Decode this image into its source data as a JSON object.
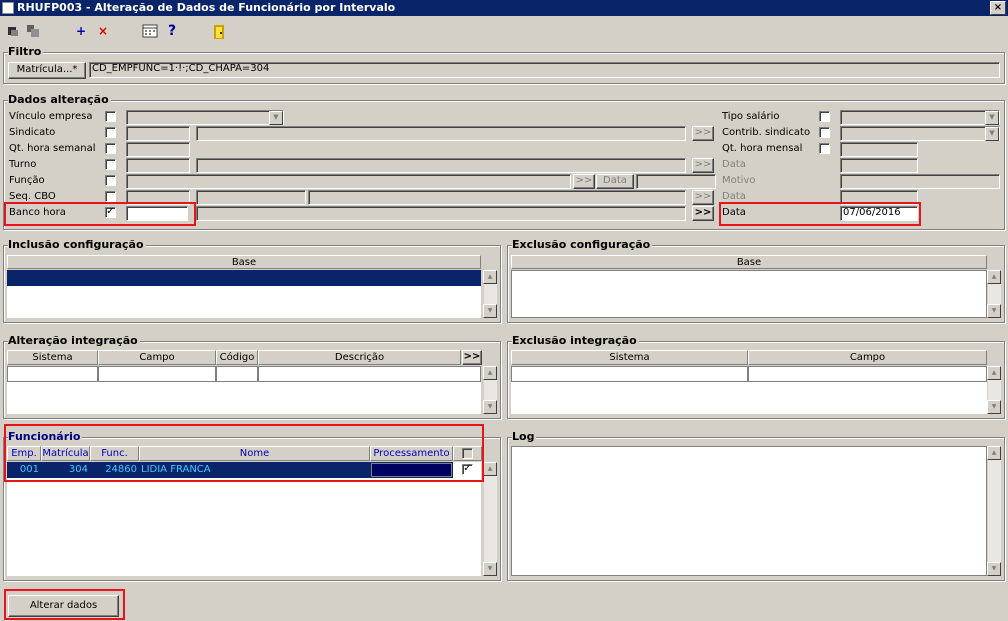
{
  "window": {
    "title": "RHUFP003 - Alteração de Dados de Funcionário por Intervalo",
    "close": "×"
  },
  "toolbar": {
    "add": "+",
    "delete": "×",
    "help": "?"
  },
  "filtro": {
    "title": "Filtro",
    "matricula_button": "Matrícula...*",
    "value": "CD_EMPFUNC=1·!·;CD_CHAPA=304"
  },
  "dados": {
    "title": "Dados alteração",
    "vinculo": "Vínculo empresa",
    "sindicato": "Sindicato",
    "qt_semanal": "Qt. hora semanal",
    "turno": "Turno",
    "funcao": "Função",
    "seq_cbo": "Seq. CBO",
    "banco_hora": "Banco hora",
    "tipo_salario": "Tipo salário",
    "contrib": "Contrib. sindicato",
    "qt_mensal": "Qt. hora mensal",
    "data1": "Data",
    "motivo": "Motivo",
    "data2": "Data",
    "data3": "Data",
    "data_value": "07/06/2016",
    "lov": ">>",
    "data_btn": "Data",
    "check": "✓"
  },
  "inclusao": {
    "title": "Inclusão configuração",
    "col": "Base"
  },
  "exclusao": {
    "title": "Exclusão configuração",
    "col": "Base"
  },
  "alt_integ": {
    "title": "Alteração integração",
    "cols": [
      "Sistema",
      "Campo",
      "Código",
      "Descrição"
    ],
    "more": ">>"
  },
  "exc_integ": {
    "title": "Exclusão integração",
    "cols": [
      "Sistema",
      "Campo"
    ]
  },
  "funcionario": {
    "title": "Funcionário",
    "cols": [
      "Emp.",
      "Matrícula",
      "Func.",
      "Nome",
      "Processamento"
    ],
    "row": {
      "emp": "001",
      "mat": "304",
      "func": "24860",
      "nome": "LIDIA FRANCA",
      "proc": ""
    }
  },
  "log": {
    "title": "Log"
  },
  "alterar_button": "Alterar dados"
}
